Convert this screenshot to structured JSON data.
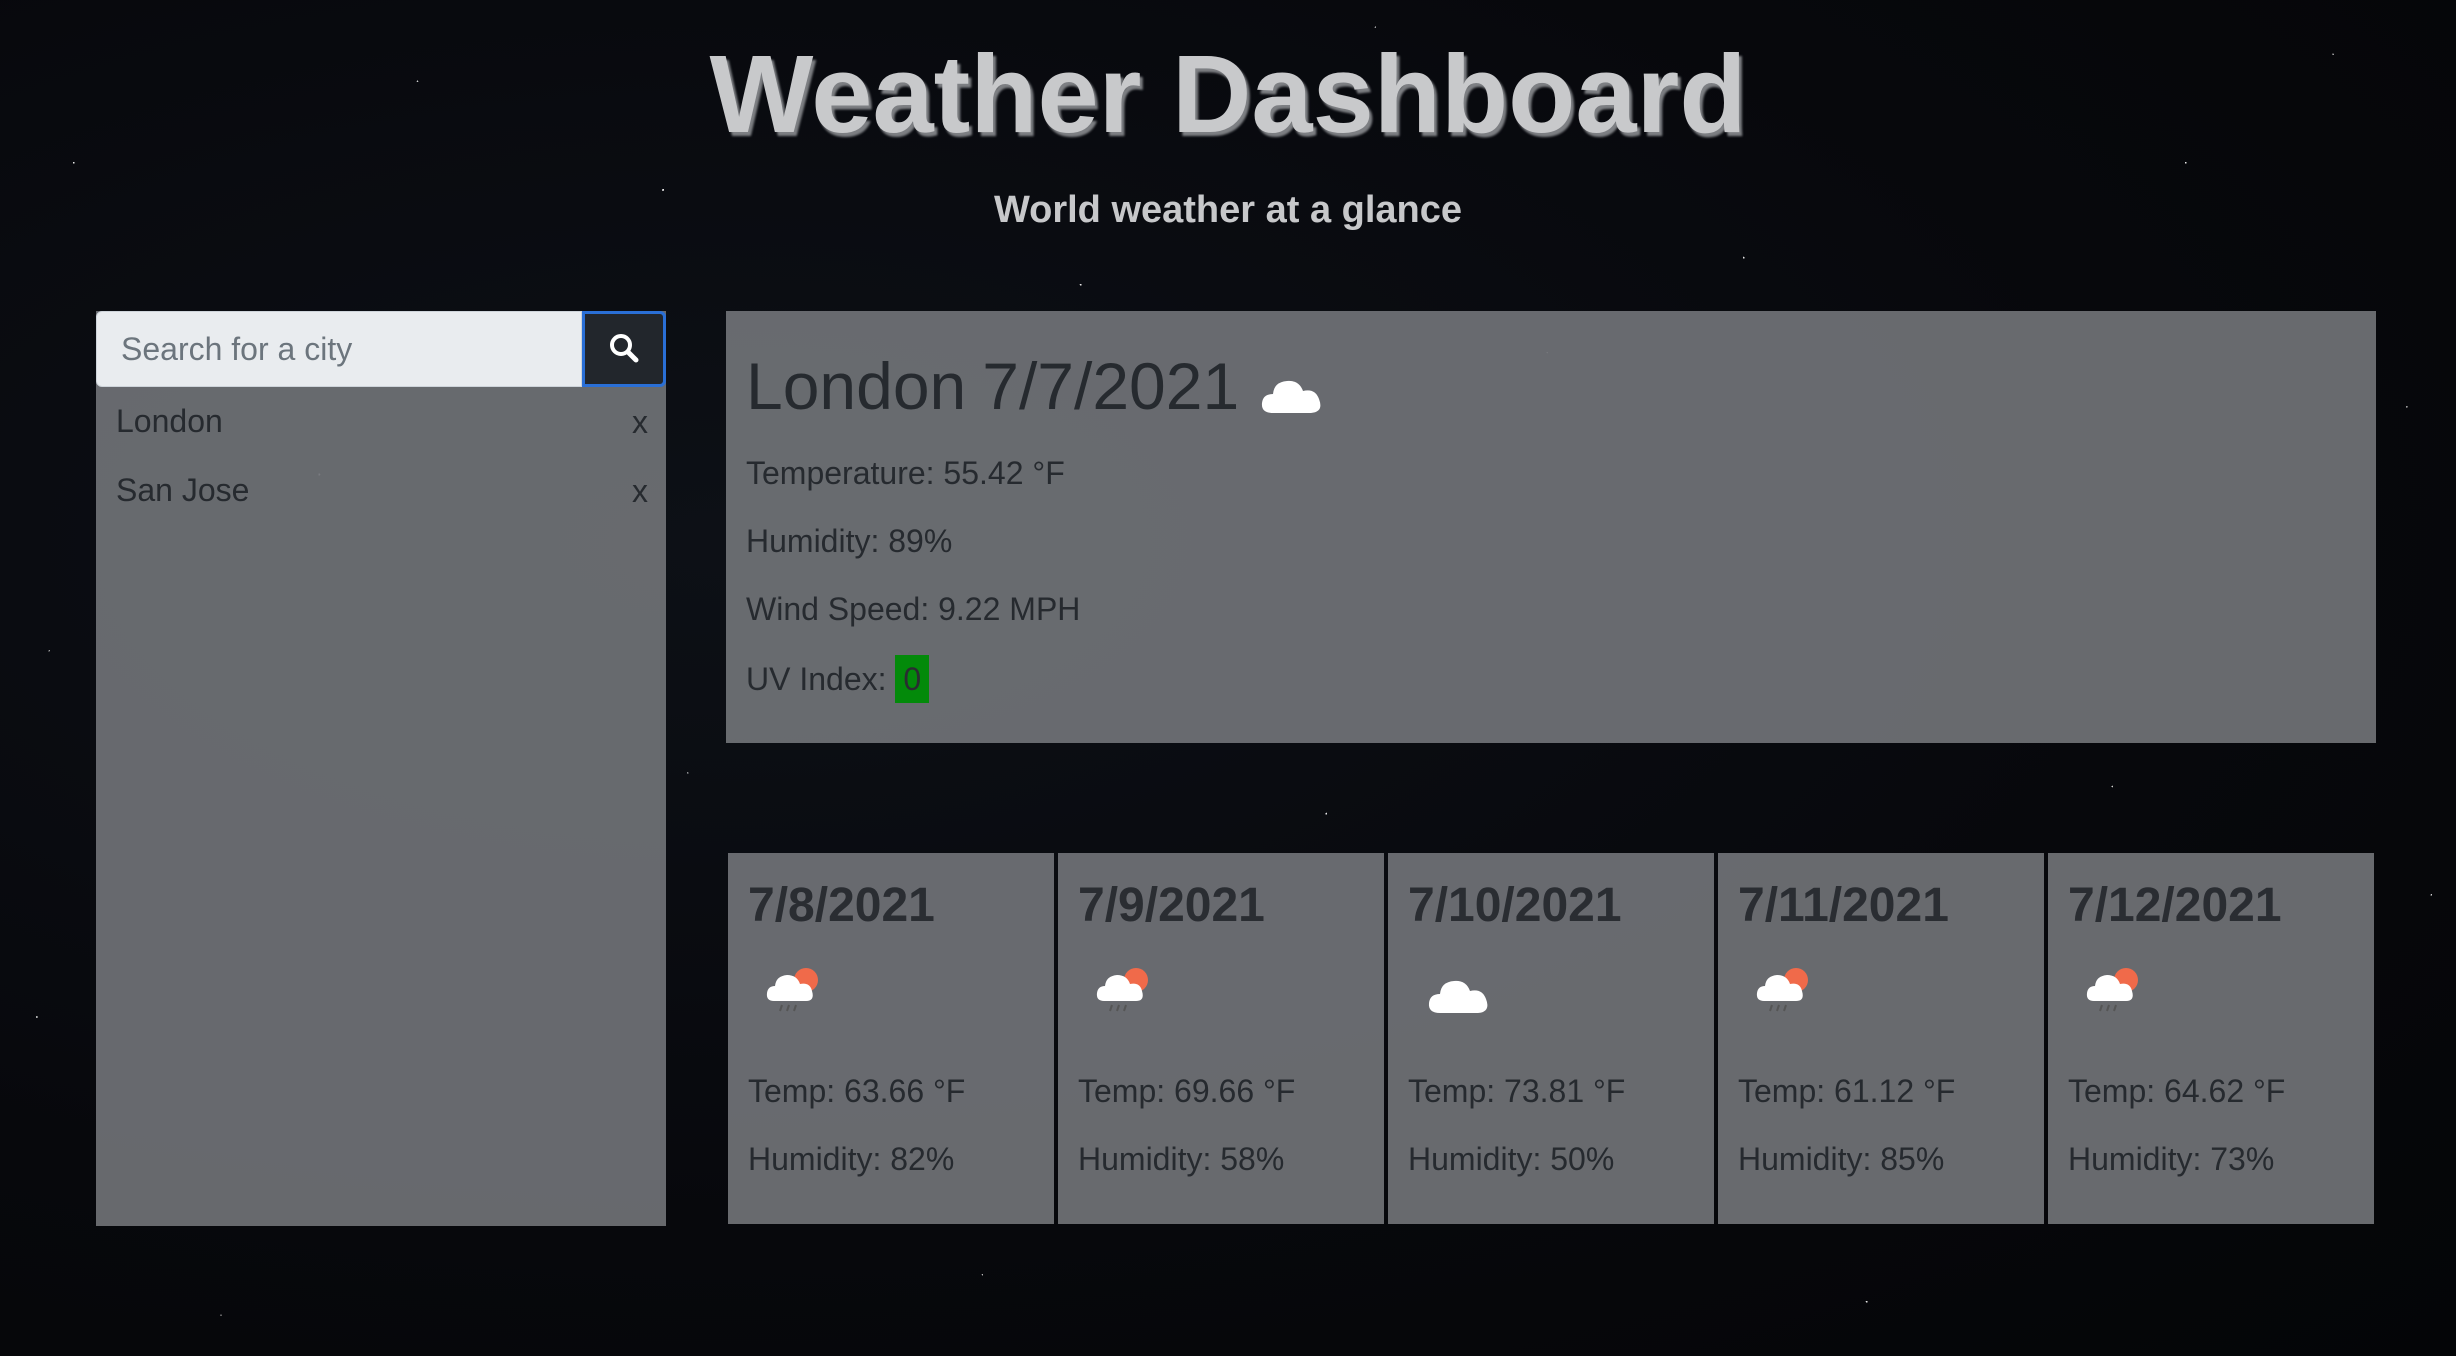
{
  "header": {
    "title": "Weather Dashboard",
    "subtitle": "World weather at a glance"
  },
  "search": {
    "placeholder": "Search for a city",
    "value": "",
    "button_icon": "search-icon"
  },
  "history": [
    {
      "city": "London",
      "remove_label": "x"
    },
    {
      "city": "San Jose",
      "remove_label": "x"
    }
  ],
  "current": {
    "city": "London",
    "date": "7/7/2021",
    "icon": "cloud-icon",
    "temperature": "Temperature: 55.42 °F",
    "humidity": "Humidity: 89%",
    "wind": "Wind Speed: 9.22 MPH",
    "uv_label": "UV Index:",
    "uv_value": "0",
    "uv_color": "#038a0a"
  },
  "forecast": [
    {
      "date": "7/8/2021",
      "icon": "rain-sun-cloud-icon",
      "temp": "Temp: 63.66 °F",
      "humidity": "Humidity: 82%"
    },
    {
      "date": "7/9/2021",
      "icon": "rain-sun-cloud-icon",
      "temp": "Temp: 69.66 °F",
      "humidity": "Humidity: 58%"
    },
    {
      "date": "7/10/2021",
      "icon": "cloud-icon",
      "temp": "Temp: 73.81 °F",
      "humidity": "Humidity: 50%"
    },
    {
      "date": "7/11/2021",
      "icon": "rain-sun-cloud-icon",
      "temp": "Temp: 61.12 °F",
      "humidity": "Humidity: 85%"
    },
    {
      "date": "7/12/2021",
      "icon": "rain-sun-cloud-icon",
      "temp": "Temp: 64.62 °F",
      "humidity": "Humidity: 73%"
    }
  ],
  "colors": {
    "panel": "#707276",
    "search_button": "#22262c",
    "search_button_border": "#2a6fd6",
    "title": "#c8c9cb"
  }
}
